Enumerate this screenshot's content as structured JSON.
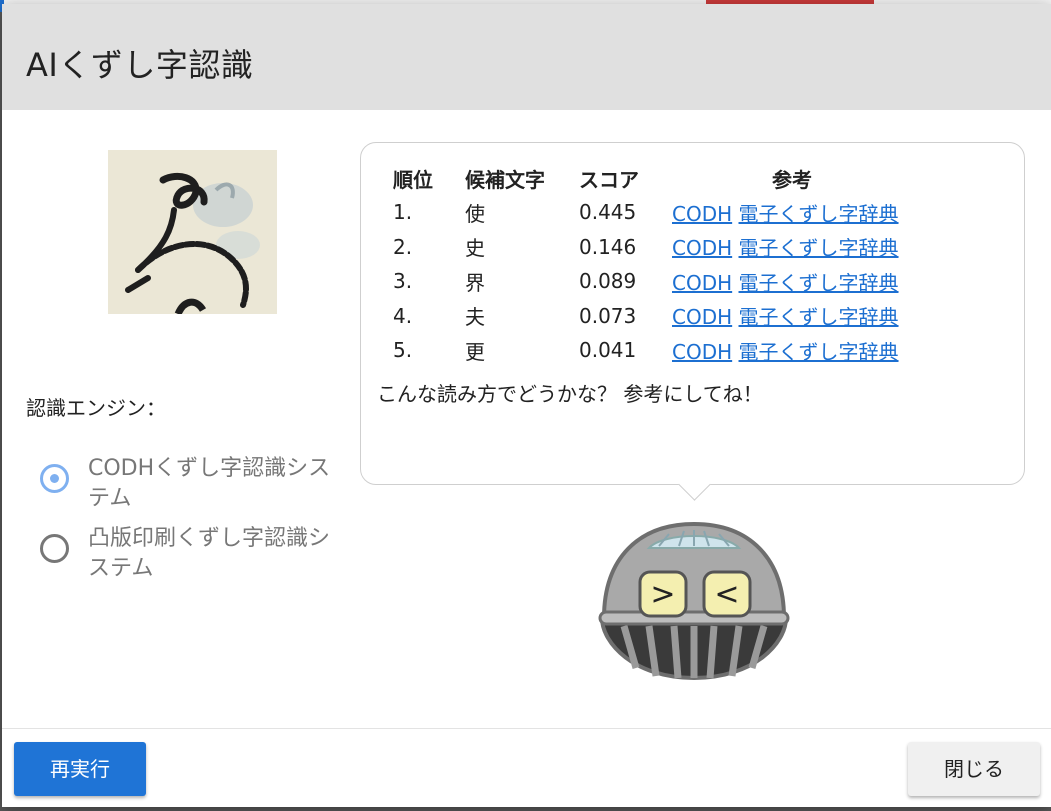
{
  "dialog": {
    "title": "AIくずし字認識"
  },
  "engine": {
    "label": "認識エンジン：",
    "options": [
      {
        "label": "CODHくずし字認識システム",
        "selected": true
      },
      {
        "label": "凸版印刷くずし字認識システム",
        "selected": false
      }
    ]
  },
  "results": {
    "headers": {
      "rank": "順位",
      "candidate": "候補文字",
      "score": "スコア",
      "reference": "参考"
    },
    "rows": [
      {
        "rank": "1.",
        "candidate": "使",
        "score": "0.445",
        "link1": "CODH",
        "link2": "電子くずし字辞典"
      },
      {
        "rank": "2.",
        "candidate": "史",
        "score": "0.146",
        "link1": "CODH",
        "link2": "電子くずし字辞典"
      },
      {
        "rank": "3.",
        "candidate": "界",
        "score": "0.089",
        "link1": "CODH",
        "link2": "電子くずし字辞典"
      },
      {
        "rank": "4.",
        "candidate": "夫",
        "score": "0.073",
        "link1": "CODH",
        "link2": "電子くずし字辞典"
      },
      {
        "rank": "5.",
        "candidate": "更",
        "score": "0.041",
        "link1": "CODH",
        "link2": "電子くずし字辞典"
      }
    ],
    "comment": "こんな読み方でどうかな？ 参考にしてね！"
  },
  "robot": {
    "eyes_left": ">",
    "eyes_right": "<"
  },
  "footer": {
    "rerun_label": "再実行",
    "close_label": "閉じる"
  },
  "colors": {
    "accent": "#1f74d6",
    "link": "#1c6fd1",
    "radio_selected": "#7fb0f0"
  }
}
